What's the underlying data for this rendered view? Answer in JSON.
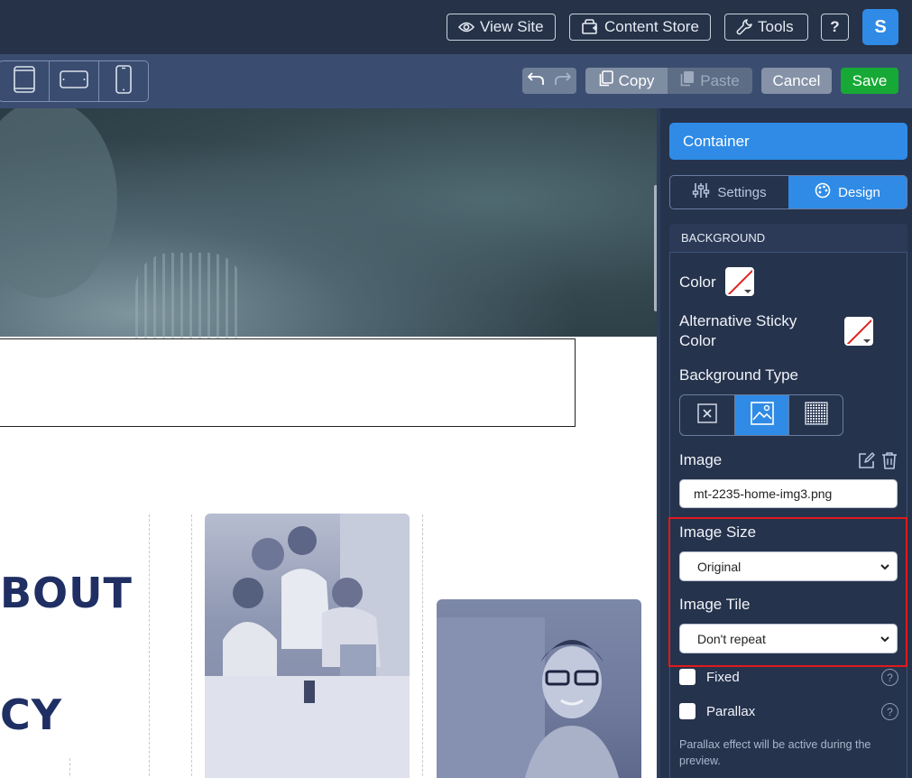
{
  "topbar": {
    "view_site": "View Site",
    "content_store": "Content Store",
    "tools": "Tools",
    "help": "?",
    "avatar_initial": "S"
  },
  "toolbar": {
    "copy": "Copy",
    "paste": "Paste",
    "cancel": "Cancel",
    "save": "Save"
  },
  "canvas": {
    "heading_line1": "BOUT",
    "heading_line2": "CY"
  },
  "panel": {
    "title": "Container",
    "tabs": [
      {
        "label": "Settings",
        "icon": "sliders-icon"
      },
      {
        "label": "Design",
        "icon": "palette-icon"
      }
    ],
    "section_title": "BACKGROUND",
    "color_label": "Color",
    "alt_sticky_label_1": "Alternative Sticky",
    "alt_sticky_label_2": "Color",
    "bg_type_label": "Background Type",
    "image_label": "Image",
    "image_value": "mt-2235-home-img3.png",
    "image_size_label": "Image Size",
    "image_size_value": "Original",
    "image_tile_label": "Image Tile",
    "image_tile_value": "Don't repeat",
    "fixed_label": "Fixed",
    "parallax_label": "Parallax",
    "parallax_note": "Parallax effect will be active during the preview.",
    "help": "?"
  },
  "colors": {
    "accent": "#2f8be6",
    "save": "#17a935",
    "highlight": "#e01a1a",
    "heading": "#1f2f63"
  }
}
